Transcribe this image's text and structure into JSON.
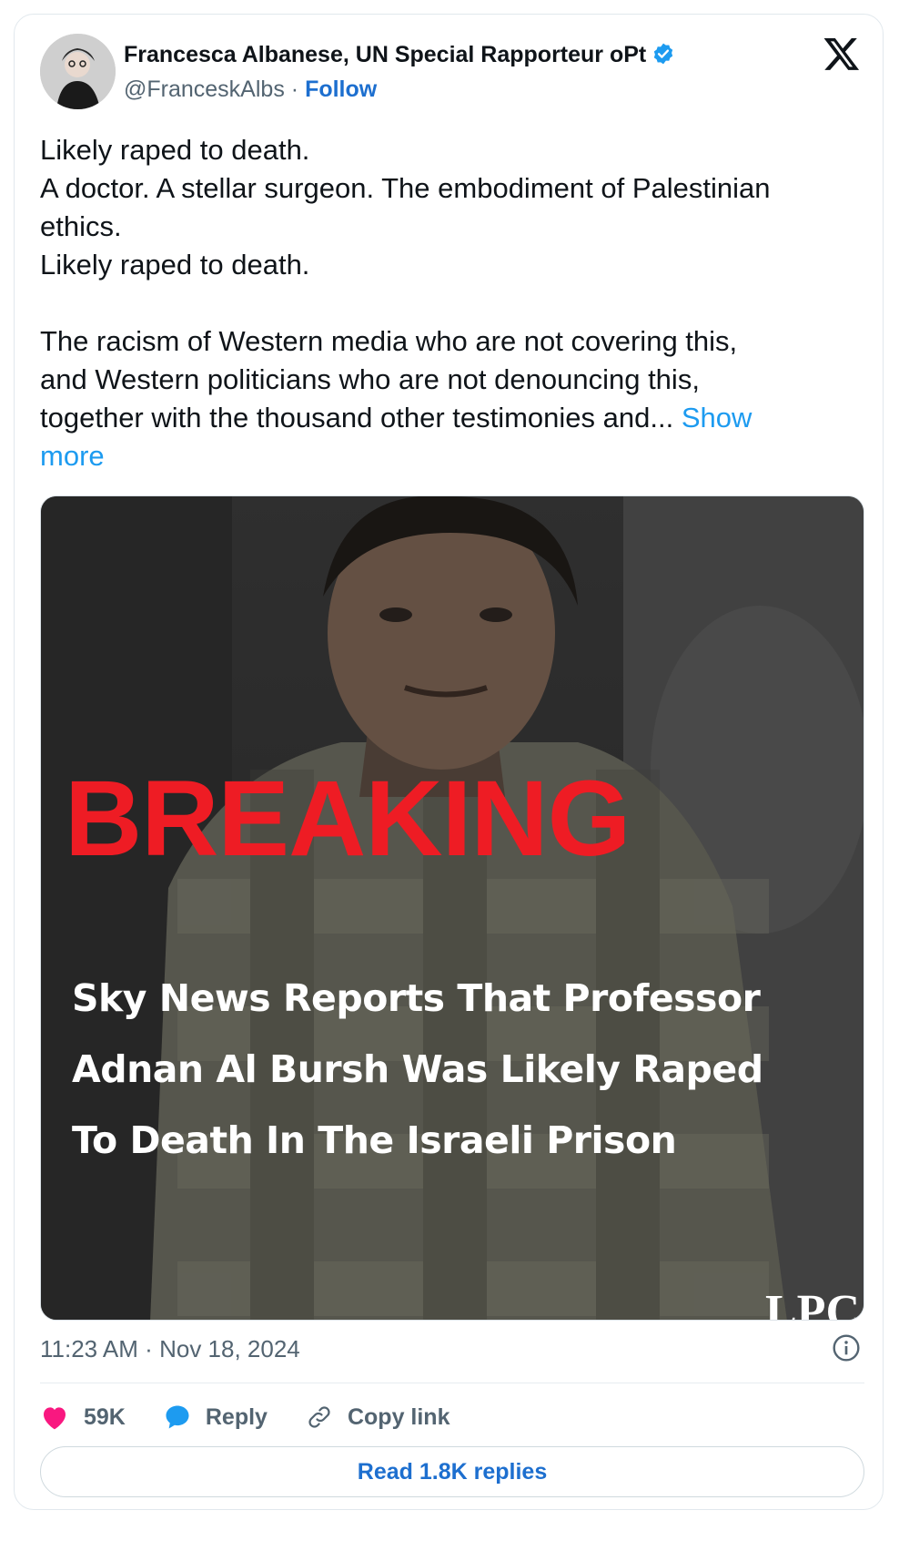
{
  "author": {
    "name": "Francesca Albanese, UN Special Rapporteur oPt",
    "handle": "@FranceskAlbs",
    "separator": "·",
    "follow_label": "Follow",
    "verified": true,
    "verified_color": "#1d9bf0"
  },
  "tweet": {
    "lines": [
      "Likely raped to death.",
      "A doctor. A stellar surgeon. The embodiment of Palestinian",
      "ethics.",
      "Likely raped to death.",
      "",
      "The racism of Western media who are not covering this,",
      "and Western politicians who are not denouncing this,"
    ],
    "last_line": "together with the thousand other testimonies and...",
    "show_more_1": "Show",
    "show_more_2": "more"
  },
  "media": {
    "breaking": "BREAKING",
    "headline": [
      "Sky News Reports That Professor",
      "Adnan Al Bursh Was Likely Raped",
      "To Death In The Israeli Prison"
    ],
    "watermark": "LPC",
    "breaking_color": "#ee1c24"
  },
  "meta": {
    "time": "11:23 AM",
    "separator": "·",
    "date": "Nov 18, 2024"
  },
  "actions": {
    "likes": "59K",
    "reply_label": "Reply",
    "copy_label": "Copy link",
    "like_color": "#f91880",
    "reply_color": "#1d9bf0"
  },
  "footer": {
    "read_replies": "Read 1.8K replies"
  },
  "icons": [
    "x-logo-icon",
    "verified-badge-icon",
    "heart-icon",
    "reply-bubble-icon",
    "link-icon",
    "info-icon"
  ]
}
